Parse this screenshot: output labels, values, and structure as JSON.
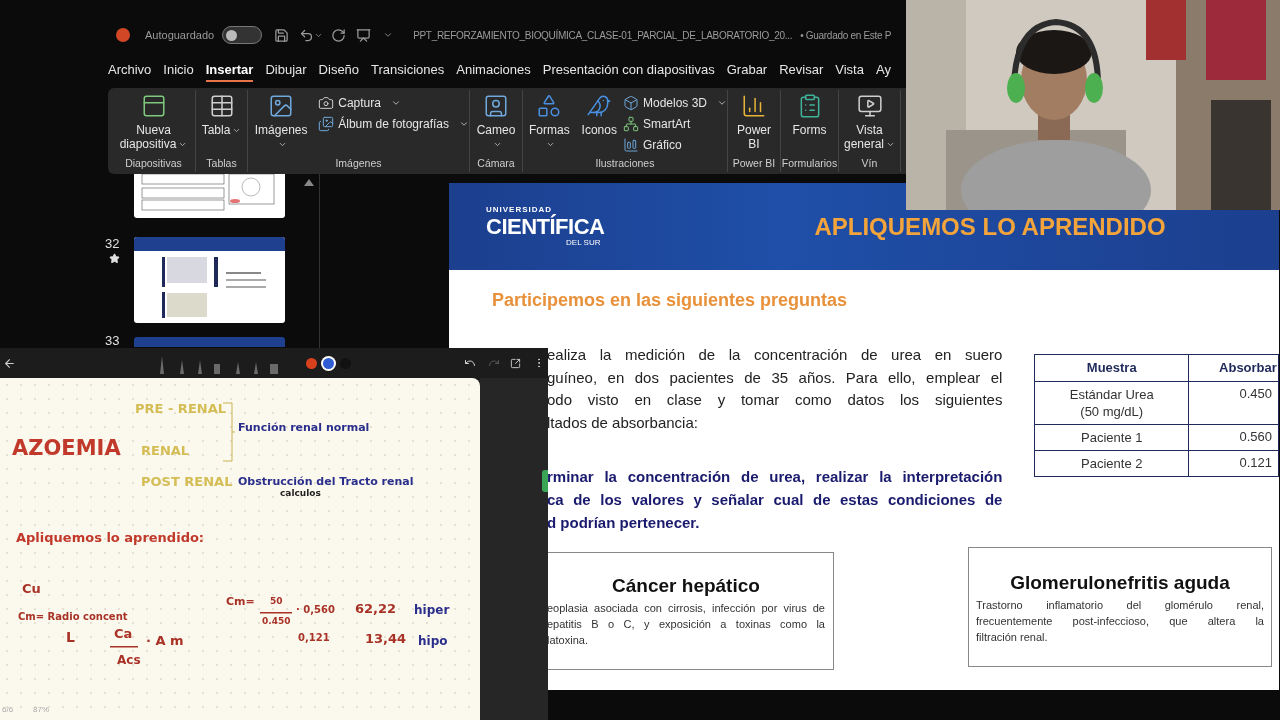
{
  "titlebar": {
    "autosave_label": "Autoguardado",
    "autosave_on": false,
    "file_name": "PPT_REFORZAMIENTO_BIOQUÍMICA_CLASE-01_PARCIAL_DE_LABORATORIO_20...",
    "save_status": "• Guardado en Este P"
  },
  "menu_tabs": [
    {
      "label": "Archivo",
      "selected": false
    },
    {
      "label": "Inicio",
      "selected": false
    },
    {
      "label": "Insertar",
      "selected": true
    },
    {
      "label": "Dibujar",
      "selected": false
    },
    {
      "label": "Diseño",
      "selected": false
    },
    {
      "label": "Transiciones",
      "selected": false
    },
    {
      "label": "Animaciones",
      "selected": false
    },
    {
      "label": "Presentación con diapositivas",
      "selected": false
    },
    {
      "label": "Grabar",
      "selected": false
    },
    {
      "label": "Revisar",
      "selected": false
    },
    {
      "label": "Vista",
      "selected": false
    },
    {
      "label": "Ay",
      "selected": false
    }
  ],
  "ribbon_groups": [
    {
      "label": "Diapositivas",
      "large_buttons": [
        {
          "label": "Nueva diapositiva",
          "dropdown": true
        }
      ]
    },
    {
      "label": "Tablas",
      "large_buttons": [
        {
          "label": "Tabla",
          "dropdown": true
        }
      ]
    },
    {
      "label": "Imágenes",
      "large_buttons": [
        {
          "label": "Imágenes",
          "dropdown": true
        }
      ],
      "small_buttons": [
        {
          "label": "Captura",
          "dropdown": true
        },
        {
          "label": "Álbum de fotografías",
          "dropdown": true
        }
      ]
    },
    {
      "label": "Cámara",
      "large_buttons": [
        {
          "label": "Cameo",
          "dropdown": true
        }
      ]
    },
    {
      "label": "Ilustraciones",
      "large_buttons": [
        {
          "label": "Formas",
          "dropdown": true
        },
        {
          "label": "Iconos",
          "dropdown": false
        }
      ],
      "small_buttons": [
        {
          "label": "Modelos 3D",
          "dropdown": true
        },
        {
          "label": "SmartArt",
          "dropdown": false
        },
        {
          "label": "Gráfico",
          "dropdown": false
        }
      ]
    },
    {
      "label": "Power BI",
      "large_buttons": [
        {
          "label": "Power BI",
          "dropdown": false
        }
      ]
    },
    {
      "label": "Formularios",
      "large_buttons": [
        {
          "label": "Forms",
          "dropdown": false
        }
      ]
    },
    {
      "label": "Vín",
      "large_buttons": [
        {
          "label": "Vista general",
          "dropdown": true
        }
      ]
    }
  ],
  "slide_thumbnails": [
    {
      "kind": "partial"
    },
    {
      "kind": "full",
      "number": "32",
      "animated": true
    },
    {
      "kind": "edge",
      "number": "33",
      "animated": false
    }
  ],
  "slide": {
    "logo_top": "UNIVERSIDAD",
    "logo_main": "CIENTÍFICA",
    "logo_sub": "DEL SUR",
    "title": "APLIQUEMOS LO APRENDIDO",
    "subtitle": "Participemos en las siguientes preguntas",
    "paragraph_lines": [
      "ealiza la medición de la concentración de urea en suero",
      "guíneo, en dos pacientes de 35 años. Para ello, emplear el",
      "odo visto en clase y tomar como datos los siguientes",
      "ltados de absorbancia:"
    ],
    "task_lines": [
      "rminar la concentración de urea, realizar la interpretación",
      "ca de los valores y señalar cual de estas condiciones de",
      "d podrían pertenecer."
    ],
    "table": {
      "columns": [
        "Muestra",
        "Absorbar"
      ],
      "rows": [
        [
          "Estándar Urea (50 mg/dL)",
          "0.450"
        ],
        [
          "Paciente 1",
          "0.560"
        ],
        [
          "Paciente 2",
          "0.121"
        ]
      ]
    },
    "cards": [
      {
        "title": "Cáncer hepático",
        "lines": [
          "eoplasia asociada con cirrosis, infección por virus de",
          "epatitis B o C, y exposición a toxinas como la",
          "latoxina."
        ]
      },
      {
        "title": "Glomerulonefritis aguda",
        "lines": [
          "Trastorno inflamatorio del glomérulo renal,",
          "frecuentemente post-infeccioso, que altera la",
          "filtración renal."
        ]
      }
    ]
  },
  "notes": {
    "pen_colors": [
      {
        "color": "#d9411e",
        "selected": false
      },
      {
        "color": "#2f5bd3",
        "selected": true
      },
      {
        "color": "#111111",
        "selected": false
      }
    ],
    "redo_disabled": true,
    "ink": [
      {
        "text": "PRE - RENAL",
        "color": "#d4bd55"
      },
      {
        "text": "AZOEMIA",
        "color": "#c0392b"
      },
      {
        "text": "RENAL",
        "color": "#d4bd55"
      },
      {
        "text": "POST RENAL",
        "color": "#d4bd55"
      },
      {
        "text": "Función renal normal",
        "color": "#2b2f8c"
      },
      {
        "text": "Obstrucción del Tracto renal",
        "color": "#2b2f8c"
      },
      {
        "text": "calculos",
        "color": "#222222"
      },
      {
        "text": "Apliquemos lo aprendido:",
        "color": "#c0392b"
      },
      {
        "text": "Cu",
        "color": "#a93226"
      },
      {
        "text": "Cm= Radio concent",
        "color": "#a93226"
      },
      {
        "text": "L",
        "color": "#a93226"
      },
      {
        "text": "Ca",
        "color": "#a93226"
      },
      {
        "text": "Acs",
        "color": "#a93226"
      },
      {
        "text": "· A m",
        "color": "#a93226"
      },
      {
        "text": "Cm=",
        "color": "#a93226"
      },
      {
        "text": "50",
        "color": "#a93226"
      },
      {
        "text": "0.450",
        "color": "#a93226"
      },
      {
        "text": "· 0,560",
        "color": "#a93226"
      },
      {
        "text": "62,22",
        "color": "#a93226"
      },
      {
        "text": "hiper",
        "color": "#2b2f8c"
      },
      {
        "text": "0,121",
        "color": "#a93226"
      },
      {
        "text": "13,44",
        "color": "#a93226"
      },
      {
        "text": "hipo",
        "color": "#2b2f8c"
      }
    ],
    "page_indicator": "6/6",
    "zoom": "87%"
  }
}
